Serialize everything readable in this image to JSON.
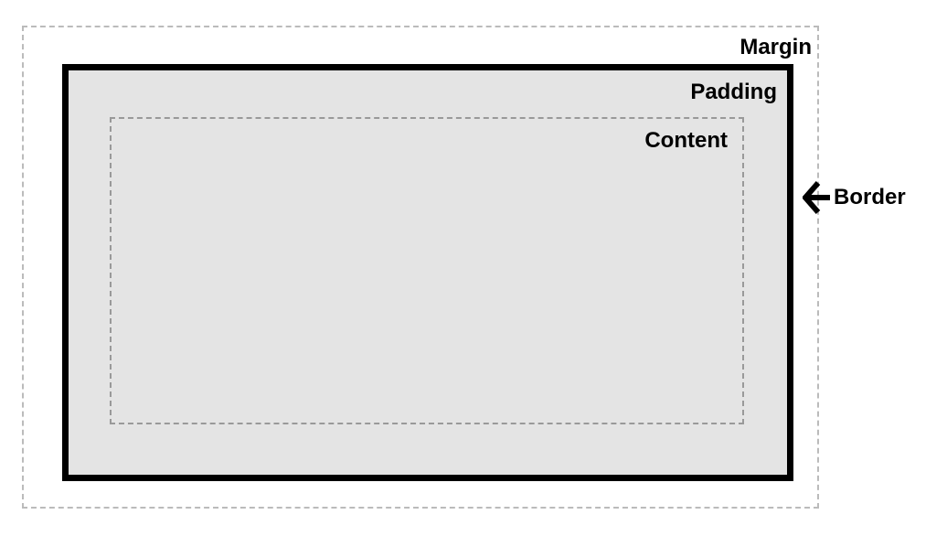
{
  "diagram": {
    "labels": {
      "margin": "Margin",
      "padding": "Padding",
      "content": "Content",
      "border": "Border"
    }
  }
}
